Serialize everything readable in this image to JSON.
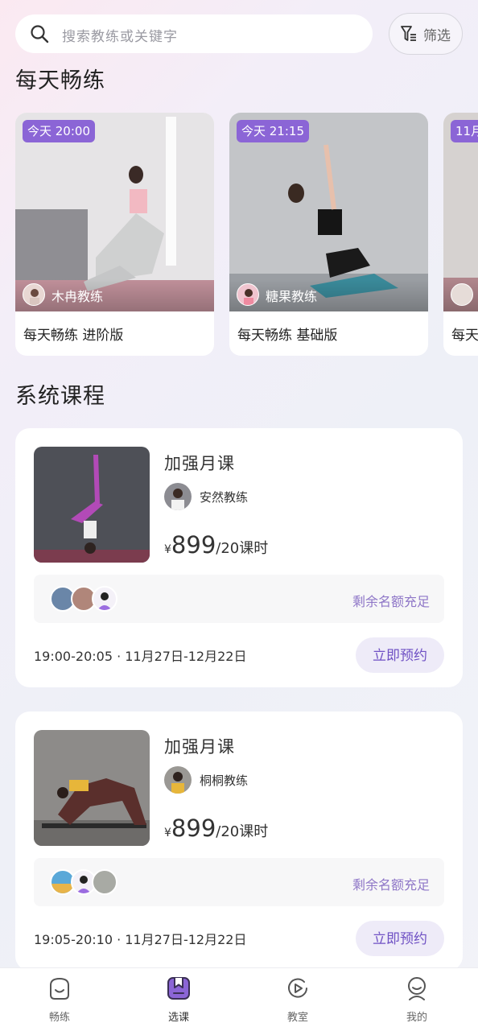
{
  "search": {
    "placeholder": "搜索教练或关键字",
    "filter_label": "筛选"
  },
  "daily": {
    "title": "每天畅练",
    "cards": [
      {
        "badge": "今天 20:00",
        "coach": "木冉教练",
        "title": "每天畅练 进阶版"
      },
      {
        "badge": "今天 21:15",
        "coach": "糖果教练",
        "title": "每天畅练 基础版"
      },
      {
        "badge": "11月",
        "coach": "",
        "title": "每天"
      }
    ]
  },
  "system": {
    "title": "系统课程",
    "courses": [
      {
        "name": "加强月课",
        "coach": "安然教练",
        "price_symbol": "¥",
        "price": "899",
        "price_unit": "/20课时",
        "quota": "剩余名额充足",
        "time": "19:00-20:05 · 11月27日-12月22日",
        "button": "立即预约"
      },
      {
        "name": "加强月课",
        "coach": "桐桐教练",
        "price_symbol": "¥",
        "price": "899",
        "price_unit": "/20课时",
        "quota": "剩余名额充足",
        "time": "19:05-20:10 · 11月27日-12月22日",
        "button": "立即预约"
      }
    ]
  },
  "tabbar": {
    "tabs": [
      {
        "label": "畅练",
        "icon": "smile-bag-icon"
      },
      {
        "label": "选课",
        "icon": "bookmark-icon",
        "active": true
      },
      {
        "label": "教室",
        "icon": "play-circle-icon"
      },
      {
        "label": "我的",
        "icon": "profile-icon"
      }
    ]
  },
  "colors": {
    "accent": "#8b65d6",
    "button_bg": "#eeebf8",
    "button_text": "#6f51c4",
    "quota_text": "#8e76c7"
  }
}
